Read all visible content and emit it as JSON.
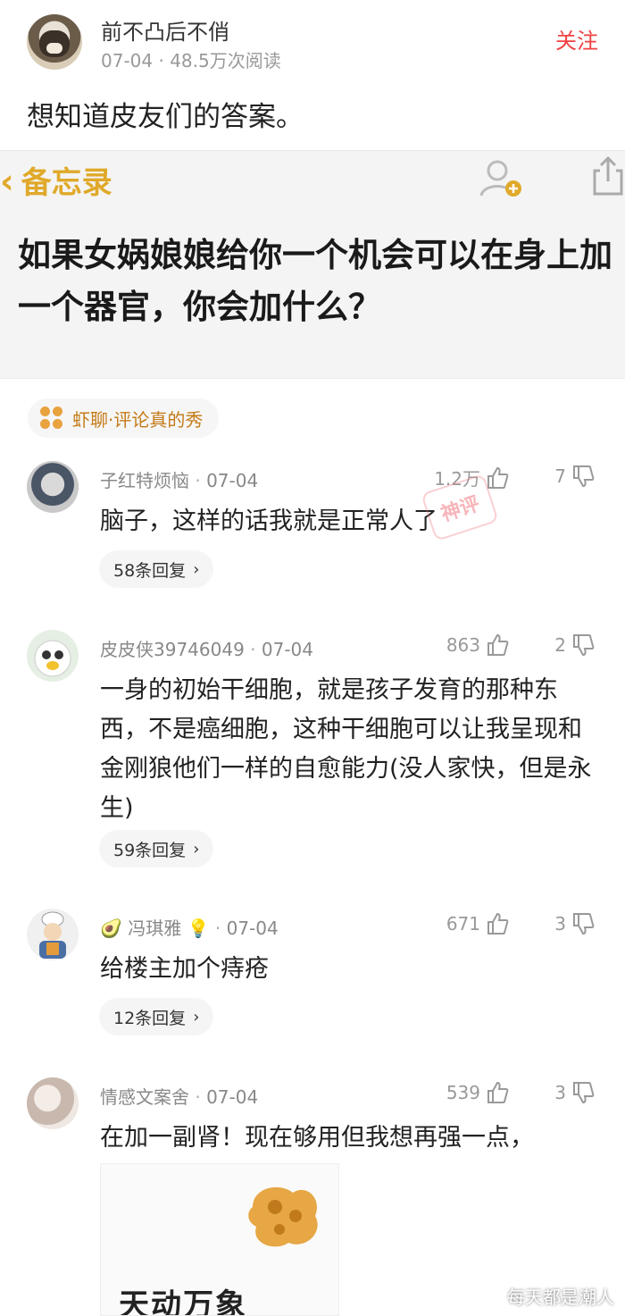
{
  "header": {
    "author_name": "前不凸后不俏",
    "meta": "07-04 · 48.5万次阅读",
    "follow_label": "关注"
  },
  "post": {
    "text": "想知道皮友们的答案。"
  },
  "memo_image": {
    "back_label": "备忘录",
    "title": "如果女娲娘娘给你一个机会可以在身上加一个器官，你会加什么？"
  },
  "topic": {
    "label": "虾聊·评论真的秀"
  },
  "comments": [
    {
      "author": "子红特烦恼",
      "date": "07-04",
      "likes": "1.2万",
      "dislikes": "7",
      "text": "脑子，这样的话我就是正常人了",
      "replies": "58条回复",
      "stamp": "神评"
    },
    {
      "author": "皮皮侠39746049",
      "date": "07-04",
      "likes": "863",
      "dislikes": "2",
      "text": "一身的初始干细胞，就是孩子发育的那种东西，不是癌细胞，这种干细胞可以让我呈现和金刚狼他们一样的自愈能力(没人家快，但是永生)",
      "replies": "59条回复"
    },
    {
      "author": "冯琪雅",
      "date": "07-04",
      "likes": "671",
      "dislikes": "3",
      "text": "给楼主加个痔疮",
      "replies": "12条回复"
    },
    {
      "author": "情感文案舍",
      "date": "07-04",
      "likes": "539",
      "dislikes": "3",
      "text": "在加一副肾！现在够用但我想再强一点，",
      "image_caption": "天动万象"
    }
  ],
  "watermark": "每天都是潮人",
  "colors": {
    "follow": "#f04142",
    "topic_text": "#c47a17",
    "memo_accent": "#e0a92a",
    "meta_gray": "#999999"
  }
}
